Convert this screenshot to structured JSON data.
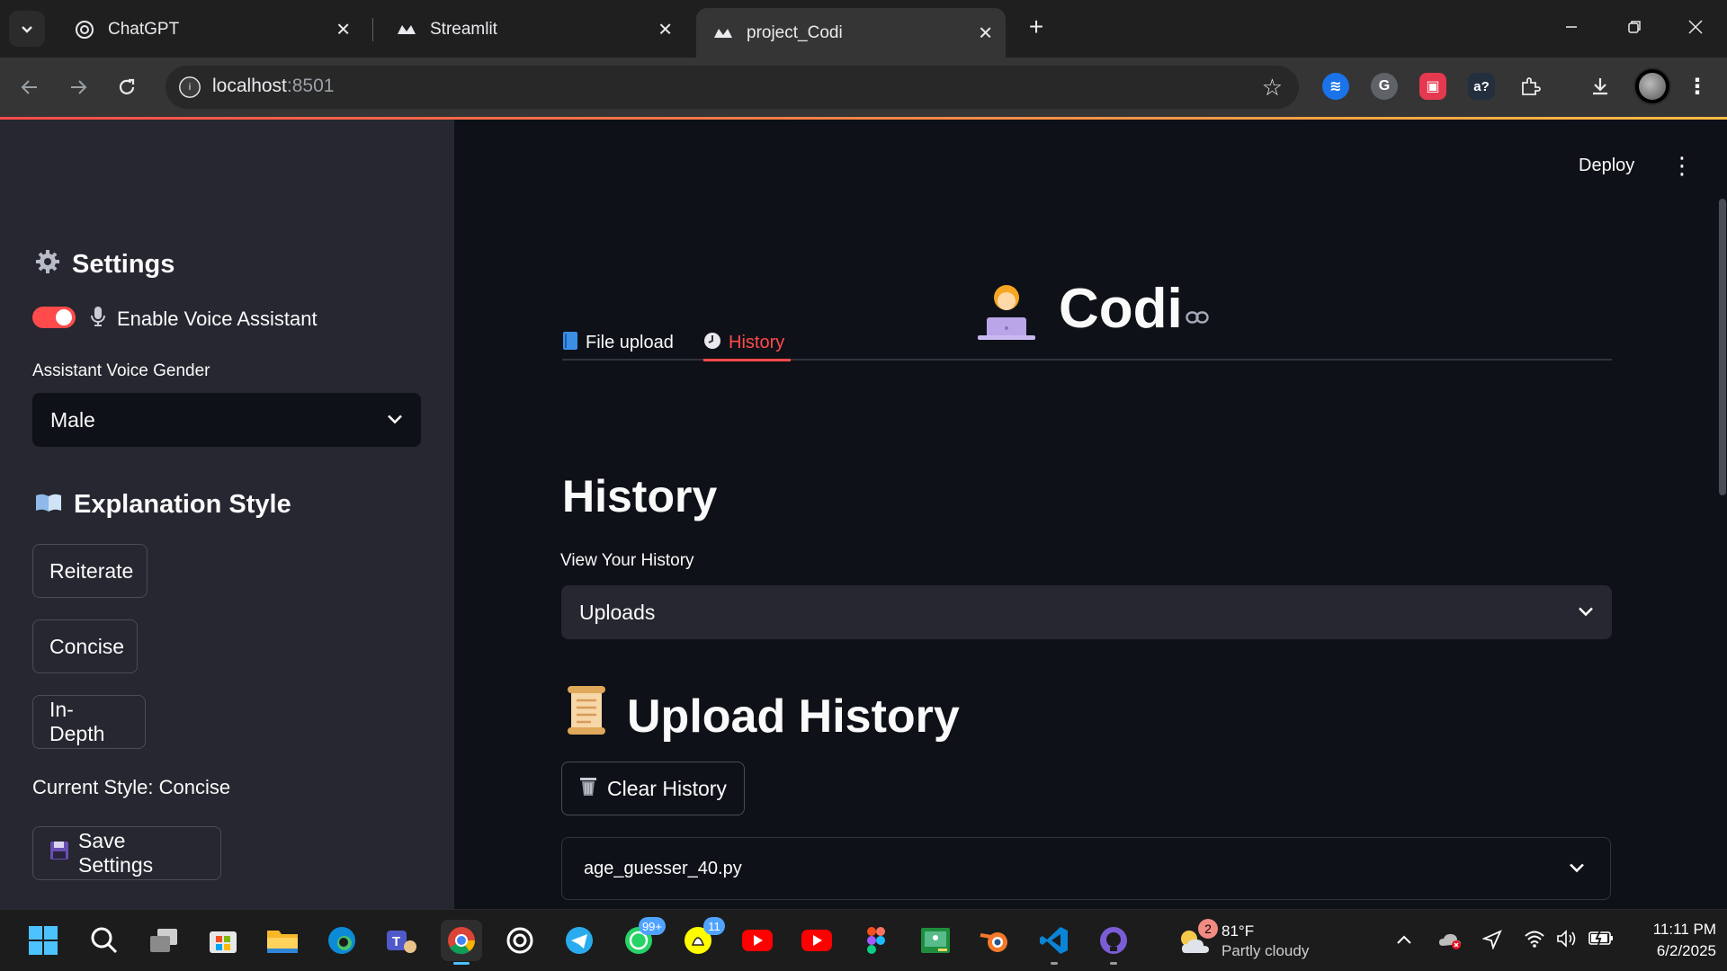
{
  "browser": {
    "tabs": [
      {
        "title": "ChatGPT",
        "icon": "chatgpt-icon"
      },
      {
        "title": "Streamlit",
        "icon": "streamlit-icon"
      },
      {
        "title": "project_Codi",
        "icon": "streamlit-icon",
        "active": true
      }
    ],
    "url_host": "localhost",
    "url_port": ":8501"
  },
  "sidebar": {
    "settings_heading": "Settings",
    "voice_toggle_label": "Enable Voice Assistant",
    "voice_enabled": true,
    "voice_gender_label": "Assistant Voice Gender",
    "voice_gender_value": "Male",
    "explanation_heading": "Explanation Style",
    "style_buttons": [
      "Reiterate",
      "Concise",
      "In-Depth"
    ],
    "current_style": "Current Style: Concise",
    "save_label": "Save Settings"
  },
  "main": {
    "deploy_label": "Deploy",
    "app_title": "Codi",
    "tabs": [
      {
        "label": "File upload",
        "icon": "book-icon"
      },
      {
        "label": "History",
        "icon": "clock-icon",
        "active": true
      }
    ],
    "history_heading": "History",
    "view_history_label": "View Your History",
    "view_history_value": "Uploads",
    "upload_history_heading": "Upload History",
    "clear_history_label": "Clear History",
    "first_item": "age_guesser_40.py"
  },
  "taskbar": {
    "whatsapp_badge": "99+",
    "snapchat_badge": "11",
    "weather_badge": "2",
    "weather_temp": "81°F",
    "weather_condition": "Partly cloudy",
    "time": "11:11 PM",
    "date": "6/2/2025"
  },
  "colors": {
    "accent": "#ff4b4b",
    "sidebar_bg": "#262730",
    "main_bg": "#0e1117"
  }
}
